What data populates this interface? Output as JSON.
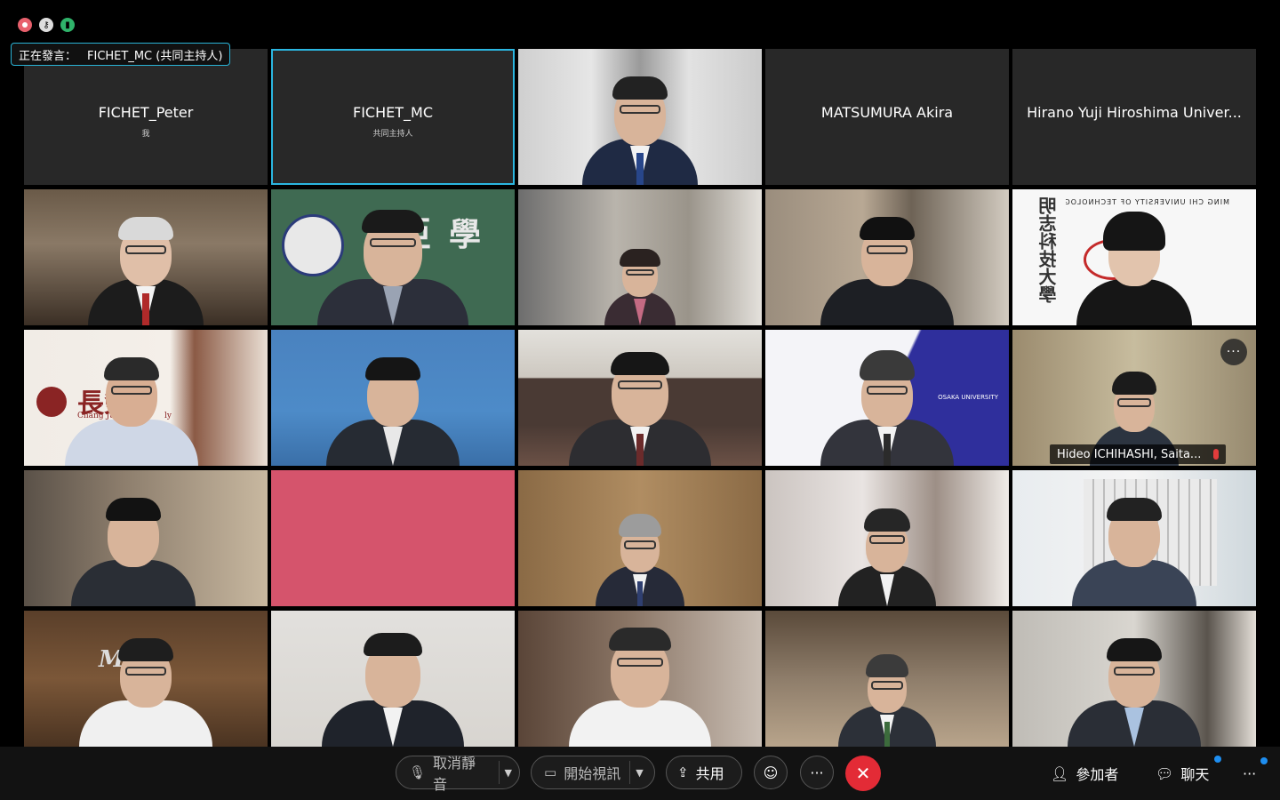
{
  "banner": {
    "label": "正在發言：",
    "speaker": "FICHET_MC (共同主持人)"
  },
  "tiles": [
    {
      "name": "FICHET_Peter",
      "role": "我"
    },
    {
      "name": "FICHET_MC",
      "role": "共同主持人"
    },
    {
      "name": ""
    },
    {
      "name": "MATSUMURA Akira"
    },
    {
      "name": "Hirano Yuji Hiroshima Univer..."
    }
  ],
  "overlays": {
    "ming_chi_banner": "MING CHI UNIVERSITY OF TECHNOLOGY",
    "ming_chi_chars": "明志科技大學",
    "chang_jung_chars": "長榮",
    "chang_jung_en": "Chang Jung Ch",
    "chang_jung_en2": "ly",
    "osaka_logo": "OSAKA UNIVERSITY",
    "asia_chars": "亞",
    "asia_chars2": "學",
    "must_logo": "Must",
    "ichihashi_tag": "Hideo ICHIHASHI, Saita...",
    "more_label": "···"
  },
  "toolbar": {
    "mute_label": "取消靜音",
    "video_label": "開始視訊",
    "share_label": "共用",
    "more_label": "···",
    "end_label": "✕",
    "participants_label": "參加者",
    "chat_label": "聊天",
    "overflow_label": "···"
  },
  "colors": {
    "active_border": "#2bb6e0",
    "end_button": "#e32b36",
    "accent_blue": "#1e8ef0"
  }
}
